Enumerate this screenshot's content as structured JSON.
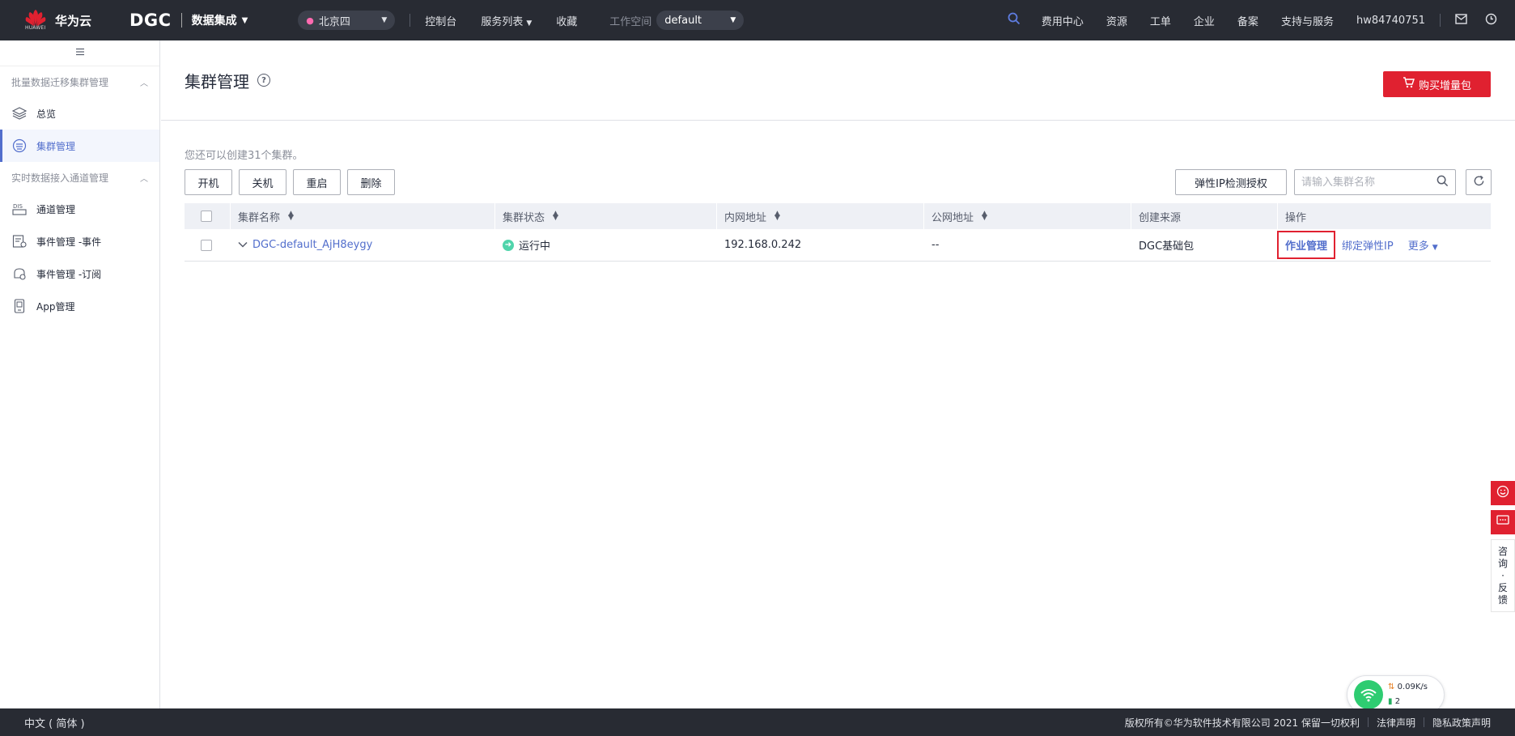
{
  "header": {
    "brand": "华为云",
    "brand_sub": "HUAWEI",
    "product": "DGC",
    "service": "数据集成",
    "region": "北京四",
    "nav": [
      "控制台",
      "服务列表",
      "收藏"
    ],
    "workspace_label": "工作空间",
    "workspace_value": "default",
    "right_links": [
      "费用中心",
      "资源",
      "工单",
      "企业",
      "备案",
      "支持与服务"
    ],
    "username": "hw84740751",
    "colors": {
      "bar": "#282b33",
      "accent": "#5e7ce0"
    }
  },
  "sidebar": {
    "groups": [
      {
        "title": "批量数据迁移集群管理",
        "items": [
          {
            "label": "总览",
            "icon": "layers-icon",
            "active": false
          },
          {
            "label": "集群管理",
            "icon": "cluster-icon",
            "active": true
          }
        ]
      },
      {
        "title": "实时数据接入通道管理",
        "items": [
          {
            "label": "通道管理",
            "icon": "dis-icon",
            "active": false
          },
          {
            "label": "事件管理 -事件",
            "icon": "event-icon",
            "active": false
          },
          {
            "label": "事件管理 -订阅",
            "icon": "subscribe-icon",
            "active": false
          },
          {
            "label": "App管理",
            "icon": "app-icon",
            "active": false
          }
        ]
      }
    ]
  },
  "page": {
    "title": "集群管理",
    "buy_button": "购买增量包",
    "quota_text": "您还可以创建31个集群。",
    "actions": [
      "开机",
      "关机",
      "重启",
      "删除"
    ],
    "eip_button": "弹性IP检测授权",
    "search_placeholder": "请输入集群名称"
  },
  "table": {
    "columns": [
      "集群名称",
      "集群状态",
      "内网地址",
      "公网地址",
      "创建来源",
      "操作"
    ],
    "rows": [
      {
        "name": "DGC-default_AjH8eygy",
        "status": "运行中",
        "inner_ip": "192.168.0.242",
        "public_ip": "--",
        "source": "DGC基础包",
        "ops": [
          "作业管理",
          "绑定弹性IP",
          "更多"
        ]
      }
    ]
  },
  "float": {
    "feedback_chars": [
      "咨",
      "询",
      "·",
      "反",
      "馈"
    ]
  },
  "network_widget": {
    "speed": "0.09K/s",
    "count": "2"
  },
  "footer": {
    "language": "中文 ( 简体 )",
    "copyright": "版权所有©华为软件技术有限公司 2021 保留一切权利",
    "links": [
      "法律声明",
      "隐私政策声明"
    ]
  }
}
